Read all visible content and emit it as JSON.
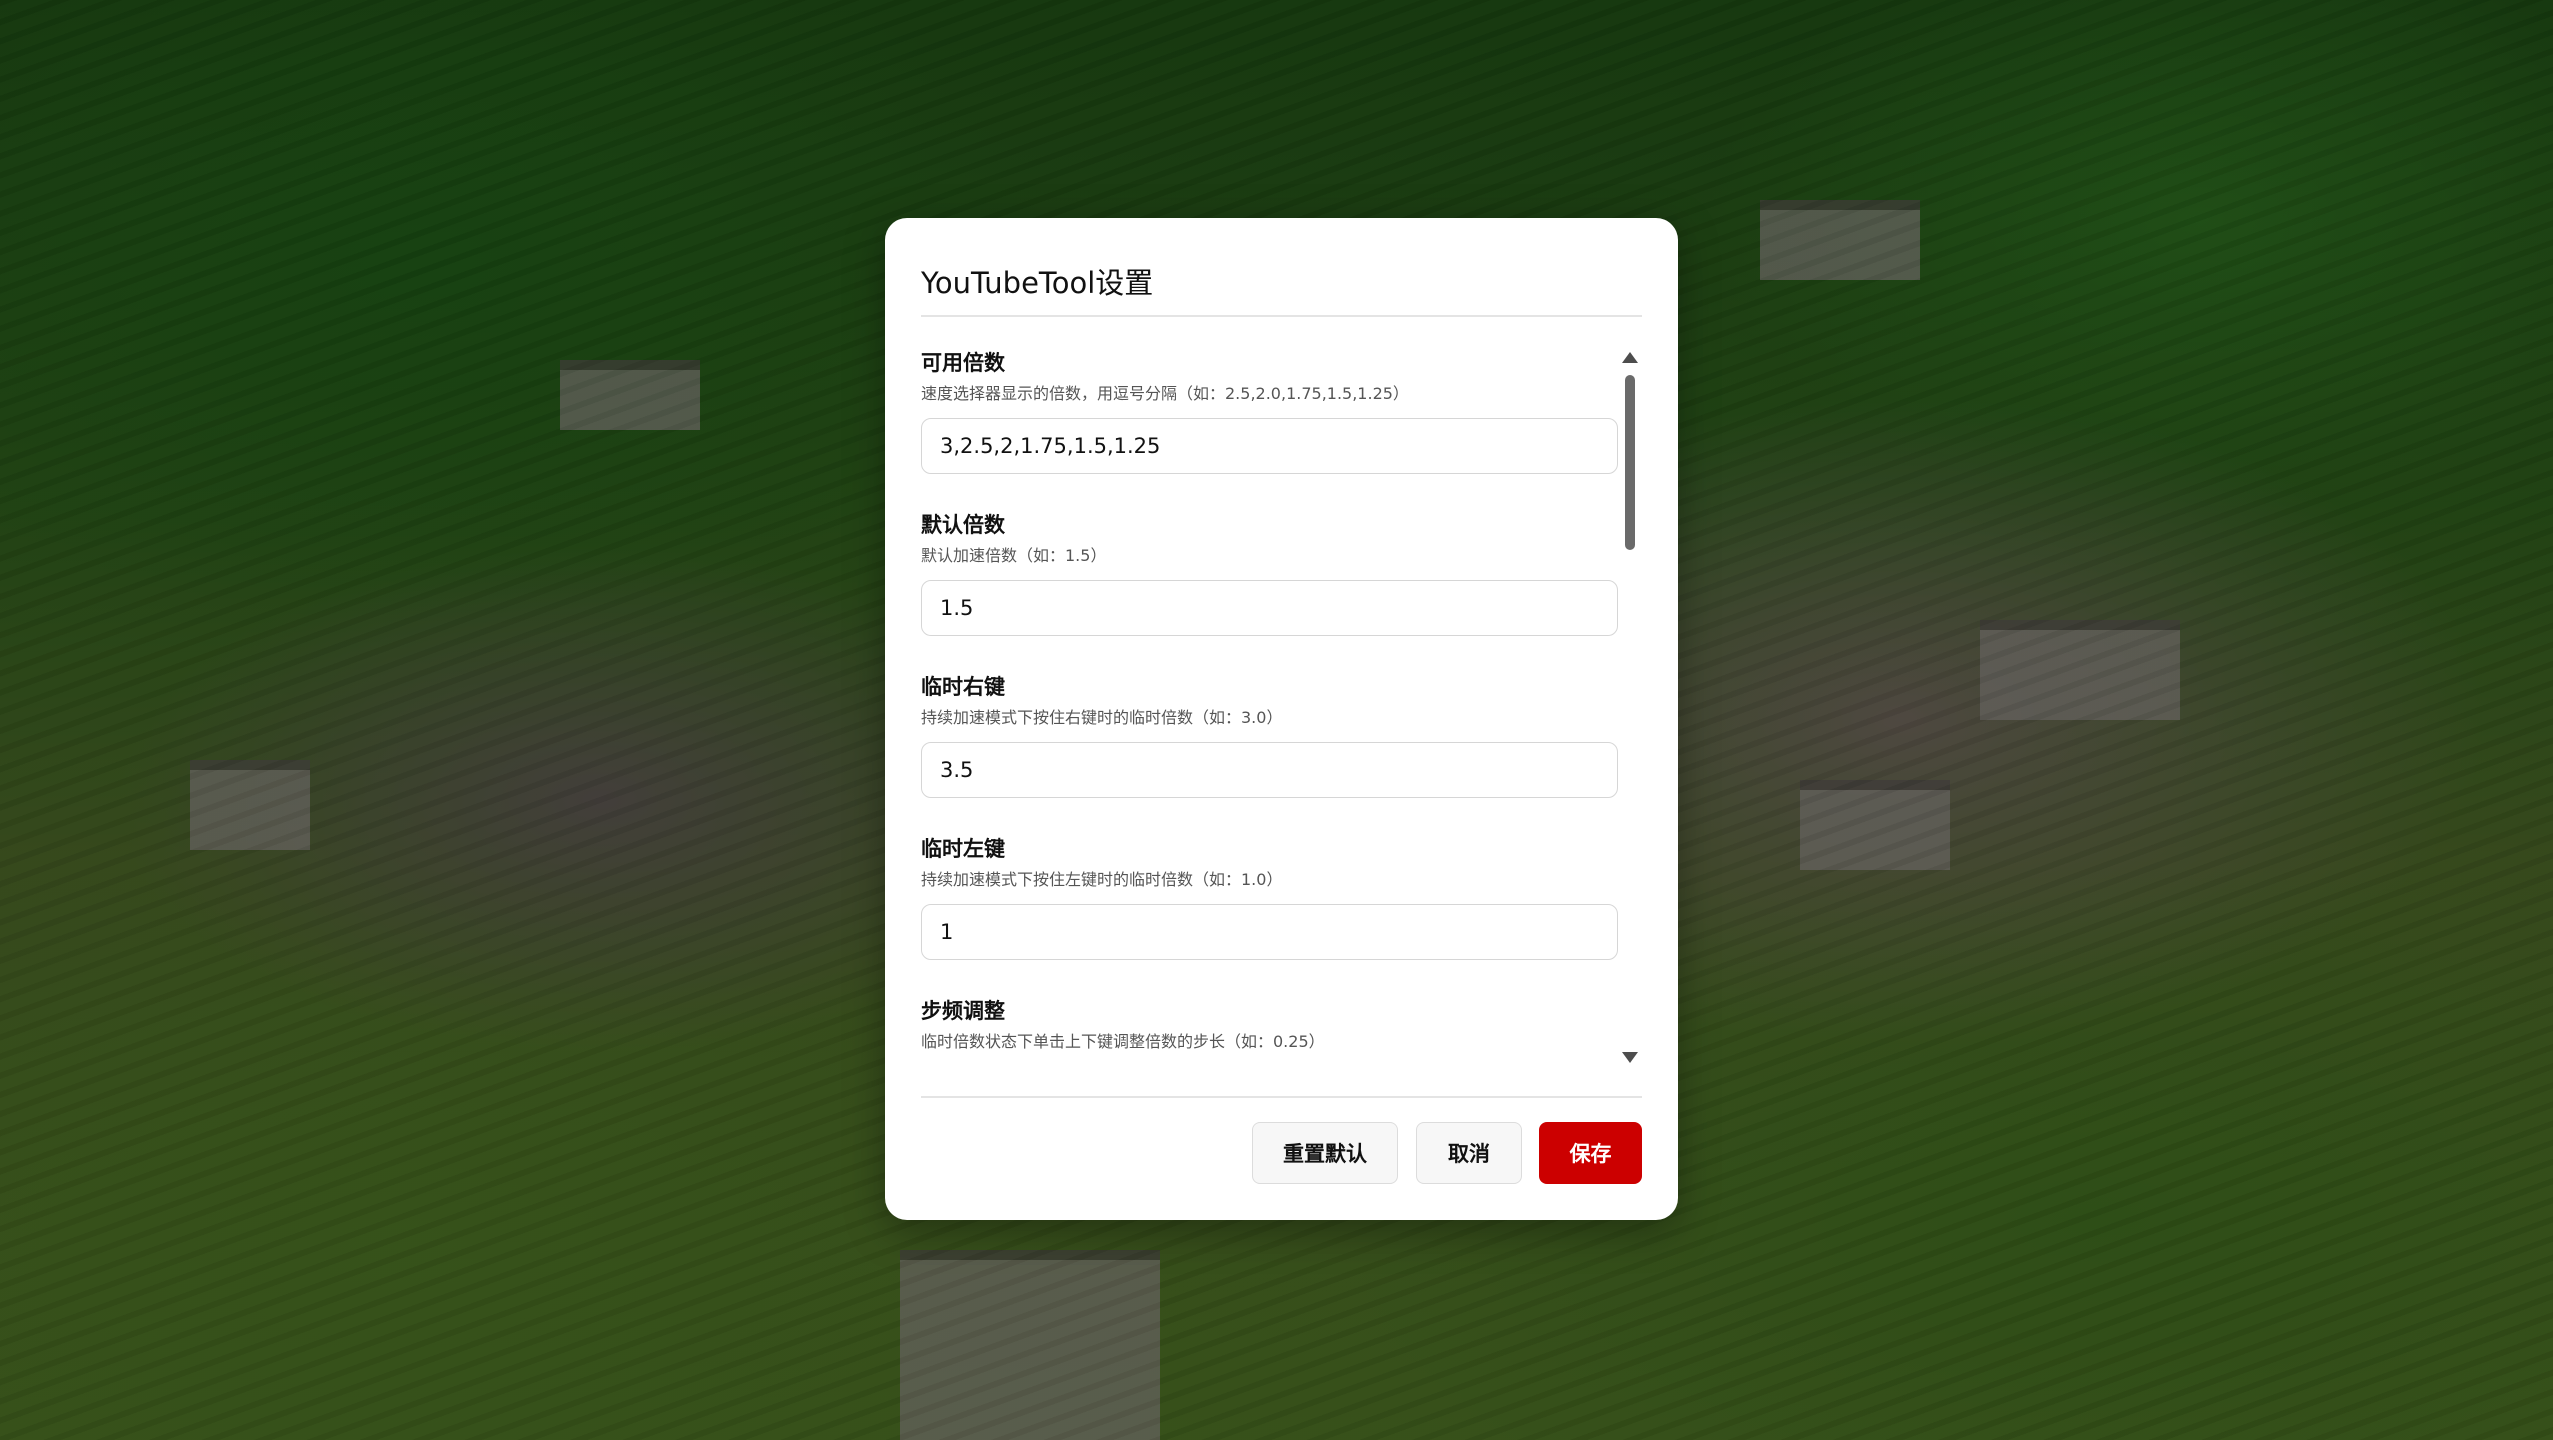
{
  "dialog": {
    "title": "YouTubeTool设置"
  },
  "settings": [
    {
      "label": "可用倍数",
      "description": "速度选择器显示的倍数，用逗号分隔（如：2.5,2.0,1.75,1.5,1.25）",
      "value": "3,2.5,2,1.75,1.5,1.25"
    },
    {
      "label": "默认倍数",
      "description": "默认加速倍数（如：1.5）",
      "value": "1.5"
    },
    {
      "label": "临时右键",
      "description": "持续加速模式下按住右键时的临时倍数（如：3.0）",
      "value": "3.5"
    },
    {
      "label": "临时左键",
      "description": "持续加速模式下按住左键时的临时倍数（如：1.0）",
      "value": "1"
    },
    {
      "label": "步频调整",
      "description": "临时倍数状态下单击上下键调整倍数的步长（如：0.25）"
    }
  ],
  "buttons": {
    "reset": "重置默认",
    "cancel": "取消",
    "save": "保存"
  },
  "colors": {
    "save_button": "#cc0000",
    "dialog_background": "#ffffff",
    "scrollbar_thumb": "#6a6a6a"
  },
  "icons": {
    "scroll_up": "triangle-up",
    "scroll_down": "triangle-down"
  }
}
